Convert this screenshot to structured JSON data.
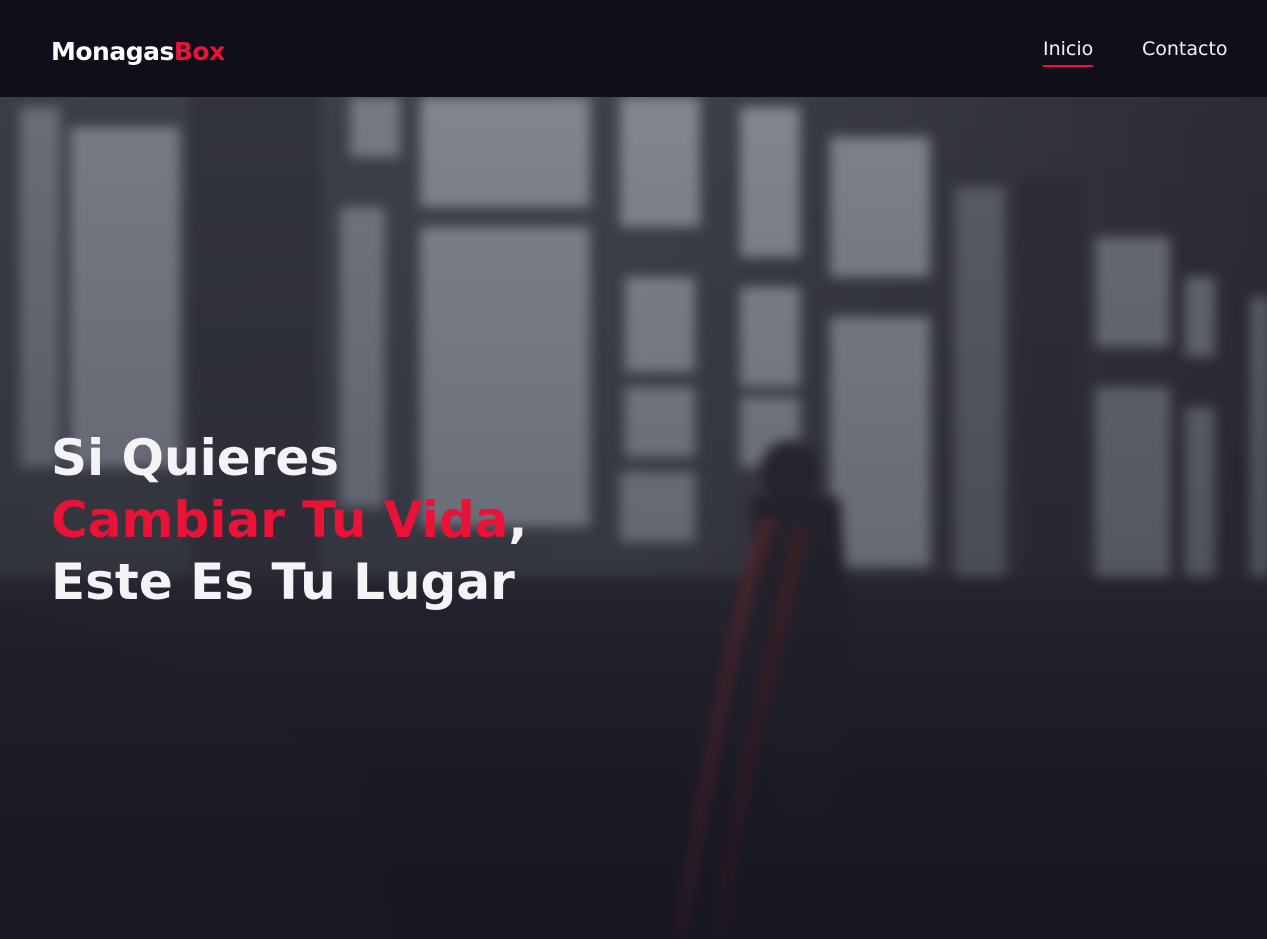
{
  "brand": {
    "name_main": "Monagas",
    "name_accent": "Box",
    "accent_color": "#ea1237"
  },
  "nav": {
    "items": [
      {
        "label": "Inicio",
        "active": true
      },
      {
        "label": "Contacto",
        "active": false
      }
    ]
  },
  "hero": {
    "line1": "Si Quieres",
    "line2_highlight": "Cambiar Tu Vida",
    "line2_suffix": ",",
    "line3": "Este Es Tu Lugar",
    "background": "blurred gym photo with large windows and a person using battle ropes"
  }
}
